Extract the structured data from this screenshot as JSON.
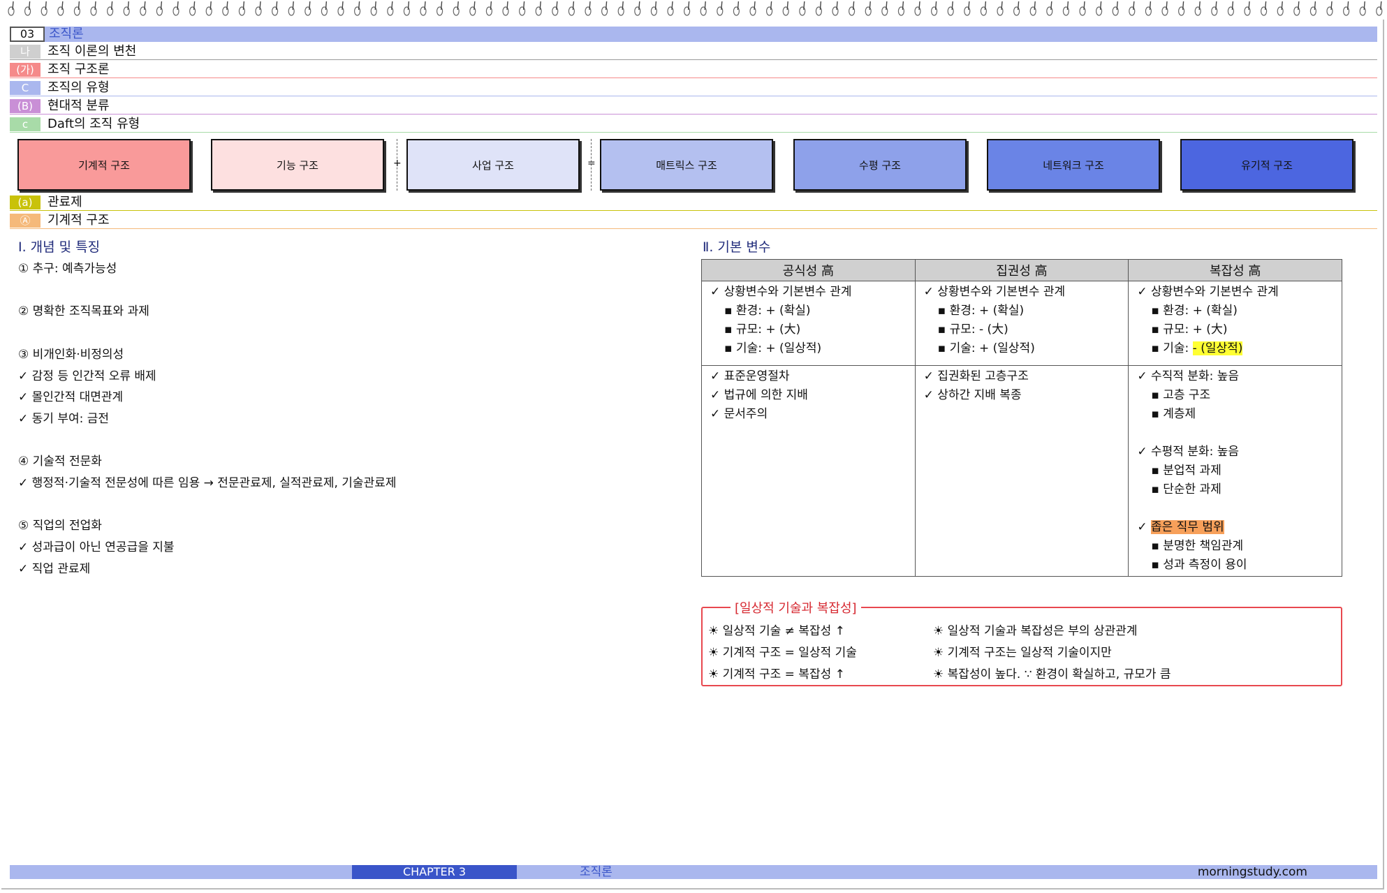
{
  "headings": {
    "chapter": {
      "num": "03",
      "title": "조직론"
    },
    "h2": {
      "badge": "나",
      "text": "조직 이론의 변천"
    },
    "h3": {
      "badge": "(가)",
      "text": "조직 구조론"
    },
    "h4": {
      "badge": "C",
      "text": "조직의 유형"
    },
    "h5": {
      "badge": "(B)",
      "text": "현대적 분류"
    },
    "h6": {
      "badge": "c",
      "text": "Daft의 조직 유형"
    },
    "h7": {
      "badge": "(a)",
      "text": "관료제"
    },
    "h8": {
      "badge": "Ⓐ",
      "text": "기계적 구조"
    }
  },
  "structures": {
    "items": [
      "기계적 구조",
      "기능 구조",
      "사업 구조",
      "매트릭스 구조",
      "수평 구조",
      "네트워크 구조",
      "유기적 구조"
    ],
    "op_plus": "+",
    "op_eq": "=",
    "colors": [
      "#f99a9a",
      "#fde0e0",
      "#dfe3f8",
      "#b4c0f0",
      "#8ea1ea",
      "#6a84e6",
      "#4c66e0"
    ]
  },
  "section1": {
    "title": "Ⅰ. 개념 및 특징",
    "lines": [
      "① 추구: 예측가능성",
      "② 명확한 조직목표와 과제",
      "③ 비개인화·비정의성",
      "✓ 감정 등 인간적 오류 배제",
      "✓ 몰인간적 대면관계",
      "✓ 동기 부여: 금전",
      "④ 기술적 전문화",
      "✓ 행정적·기술적 전문성에 따른 임용 → 전문관료제, 실적관료제, 기술관료제",
      "⑤ 직업의 전업화",
      "✓ 성과급이 아닌 연공급을 지불",
      "✓ 직업 관료제"
    ]
  },
  "section2": {
    "title": "Ⅱ. 기본 변수",
    "headers": [
      "공식성 高",
      "집권성 高",
      "복잡성 高"
    ],
    "common": "✓ 상황변수와 기본변수 관계",
    "env": "▪ 환경: + (확실)",
    "col1": {
      "size": "▪ 규모: + (大)",
      "tech": "▪ 기술: + (일상적)"
    },
    "col2": {
      "size": "▪ 규모: - (大)",
      "tech": "▪ 기술: + (일상적)"
    },
    "col3": {
      "size": "▪ 규모: + (大)",
      "tech_prefix": "▪ 기술: ",
      "tech_hl": "- (일상적)"
    },
    "row2_col1": [
      "✓ 표준운영절차",
      "✓ 법규에 의한 지배",
      "✓ 문서주의"
    ],
    "row2_col2": [
      "✓ 집권화된 고층구조",
      "✓ 상하간 지배 복종"
    ],
    "row2_col3": {
      "a": "✓ 수직적 분화: 높음",
      "a1": "▪ 고층 구조",
      "a2": "▪ 계층제",
      "b": "✓ 수평적 분화: 높음",
      "b1": "▪ 분업적 과제",
      "b2": "▪ 단순한 과제",
      "c_prefix": "✓ ",
      "c_hl": "좁은 직무 범위",
      "c1": "▪ 분명한 책임관계",
      "c2": "▪ 성과 측정이 용이"
    }
  },
  "note": {
    "title": "[일상적 기술과 복잡성]",
    "left": [
      "☀ 일상적 기술 ≠ 복잡성 ↑",
      "☀ 기계적 구조 = 일상적 기술",
      "☀ 기계적 구조 = 복잡성 ↑"
    ],
    "right": [
      "☀ 일상적 기술과 복잡성은 부의 상관관계",
      "☀ 기계적 구조는 일상적 기술이지만",
      "☀ 복잡성이 높다. ∵ 환경이 확실하고, 규모가 큼"
    ]
  },
  "footer": {
    "chapter": "CHAPTER 3",
    "title": "조직론",
    "site": "morningstudy.com"
  }
}
